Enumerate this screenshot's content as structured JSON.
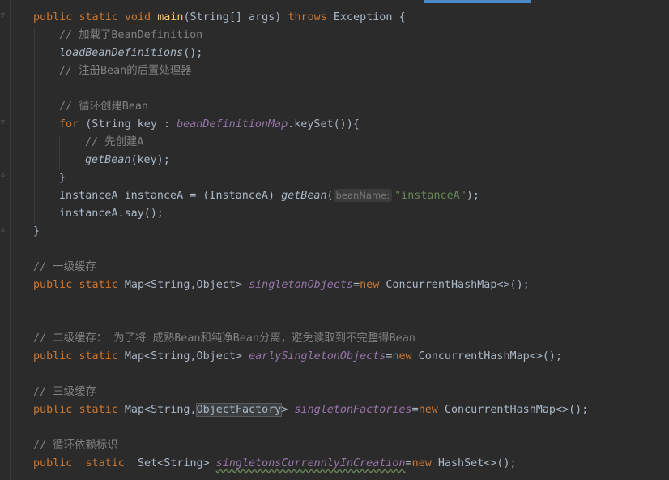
{
  "code": {
    "main_sig": {
      "public": "public",
      "static": "static",
      "void": "void",
      "name": "main",
      "params": "(String[] args) ",
      "throws": "throws",
      "rest": " Exception {"
    },
    "c_load_defs": "// 加载了BeanDefinition",
    "call_load": "loadBeanDefinitions",
    "call_load_end": "();",
    "c_register": "// 注册Bean的后置处理器",
    "c_loop": "// 循环创建Bean",
    "for_kw": "for",
    "for_mid": " (String key : ",
    "for_field": "beanDefinitionMap",
    "for_end": ".keySet()){",
    "c_create_a": "// 先创建A",
    "getbean": "getBean",
    "getbean_args": "(key);",
    "close_brace": "}",
    "inst_decl": "InstanceA instanceA = (InstanceA) ",
    "inst_call": "getBean",
    "inst_paren": "(",
    "param_hint": "beanName:",
    "inst_str": "\"instanceA\"",
    "inst_end": ");",
    "say_call": "instanceA.say();",
    "method_close": "}",
    "c_level1": "// 一级缓存",
    "l1": {
      "public": "public",
      "static": "static",
      "type": " Map<String,Object> ",
      "field": "singletonObjects",
      "eq": "=",
      "new": "new",
      "ctor": " ConcurrentHashMap<>();"
    },
    "c_level2": "// 二级缓存： 为了将 成熟Bean和纯净Bean分离，避免读取到不完整得Bean",
    "l2": {
      "public": "public",
      "static": "static",
      "type": " Map<String,Object> ",
      "field": "earlySingletonObjects",
      "eq": "=",
      "new": "new",
      "ctor": " ConcurrentHashMap<>();"
    },
    "c_level3": "// 三级缓存",
    "l3": {
      "public": "public",
      "static": "static",
      "type1": " Map<String,",
      "type_hl": "ObjectFactory",
      "type2": "> ",
      "field": "singletonFactories",
      "eq": "=",
      "new": "new",
      "ctor": " ConcurrentHashMap<>();"
    },
    "c_loop_flag": "// 循环依赖标识",
    "l4": {
      "public": "public",
      "static": "static",
      "type": "Set<String> ",
      "field": "singletonsCurrennlyInCreation",
      "eq": "=",
      "new": "new",
      "ctor": " HashSet<>();"
    }
  },
  "colors": {
    "background": "#2b2b2b",
    "keyword": "#cc7832",
    "method": "#ffc66d",
    "comment": "#808080",
    "string": "#6a8759",
    "field": "#9876aa",
    "text": "#a9b7c6"
  }
}
